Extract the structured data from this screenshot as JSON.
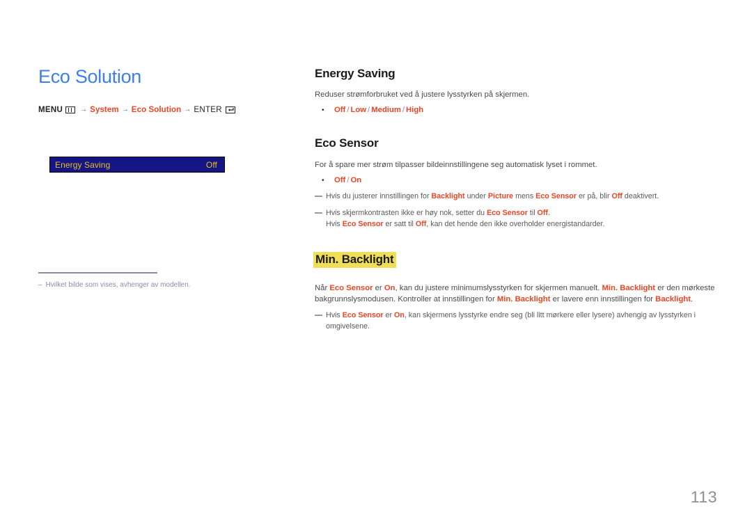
{
  "page": {
    "number": "113",
    "title": "Eco Solution",
    "title_color": "#3c7ef0",
    "accent_color": "#ef4323",
    "highlight_color": "#f0de57",
    "osd_bg_color": "#151585",
    "osd_text_color": "#e8c018"
  },
  "breadcrumb": {
    "menu_label": "MENU",
    "menu_icon": "menu-grid-icon",
    "arrow": "→",
    "step1": "System",
    "step2": "Eco Solution",
    "enter_label": "ENTER",
    "enter_icon": "enter-return-icon"
  },
  "osd": {
    "label": "Energy Saving",
    "value": "Off"
  },
  "left_footnote": {
    "dash": "–",
    "text": "Hvilket bilde som vises, avhenger av modellen."
  },
  "sections": [
    {
      "id": "energy-saving",
      "heading": "Energy Saving",
      "highlighted": false,
      "description": "Reduser strømforbruket ved å justere lysstyrken på skjermen.",
      "options": [
        "Off",
        "Low",
        "Medium",
        "High"
      ],
      "option_separator": "/",
      "notes": []
    },
    {
      "id": "eco-sensor",
      "heading": "Eco Sensor",
      "highlighted": false,
      "description": "For å spare mer strøm tilpasser bildeinnstillingene seg automatisk lyset i rommet.",
      "options": [
        "Off",
        "On"
      ],
      "option_separator": "/",
      "notes": [
        {
          "parts": [
            {
              "t": "Hvis du justerer innstillingen for ",
              "k": false
            },
            {
              "t": "Backlight",
              "k": true
            },
            {
              "t": " under ",
              "k": false
            },
            {
              "t": "Picture",
              "k": true
            },
            {
              "t": " mens ",
              "k": false
            },
            {
              "t": "Eco Sensor",
              "k": true
            },
            {
              "t": " er på, blir ",
              "k": false
            },
            {
              "t": "Off",
              "k": true
            },
            {
              "t": " deaktivert.",
              "k": false
            }
          ]
        },
        {
          "parts": [
            {
              "t": "Hvis skjermkontrasten ikke er høy nok, setter du ",
              "k": false
            },
            {
              "t": "Eco Sensor",
              "k": true
            },
            {
              "t": " til ",
              "k": false
            },
            {
              "t": "Off",
              "k": true
            },
            {
              "t": ".",
              "k": false
            }
          ],
          "sub_parts": [
            {
              "t": "Hvis ",
              "k": false
            },
            {
              "t": "Eco Sensor",
              "k": true
            },
            {
              "t": " er satt til ",
              "k": false
            },
            {
              "t": "Off",
              "k": true
            },
            {
              "t": ", kan det hende den ikke overholder energistandarder.",
              "k": false
            }
          ]
        }
      ]
    },
    {
      "id": "min-backlight",
      "heading": "Min. Backlight",
      "highlighted": true,
      "body_parts": [
        {
          "t": "Når ",
          "k": false
        },
        {
          "t": "Eco Sensor",
          "k": true
        },
        {
          "t": " er ",
          "k": false
        },
        {
          "t": "On",
          "k": true
        },
        {
          "t": ", kan du justere minimumslysstyrken for skjermen manuelt. ",
          "k": false
        },
        {
          "t": "Min. Backlight",
          "k": true
        },
        {
          "t": " er den mørkeste bakgrunnslysmodusen. Kontroller at innstillingen for ",
          "k": false
        },
        {
          "t": "Min. Backlight",
          "k": true
        },
        {
          "t": " er lavere enn innstillingen for ",
          "k": false
        },
        {
          "t": "Backlight",
          "k": true
        },
        {
          "t": ".",
          "k": false
        }
      ],
      "notes": [
        {
          "parts": [
            {
              "t": "Hvis ",
              "k": false
            },
            {
              "t": "Eco Sensor",
              "k": true
            },
            {
              "t": " er ",
              "k": false
            },
            {
              "t": "On",
              "k": true
            },
            {
              "t": ", kan skjermens lysstyrke endre seg (bli litt mørkere eller lysere) avhengig av lysstyrken i omgivelsene.",
              "k": false
            }
          ]
        }
      ]
    }
  ]
}
